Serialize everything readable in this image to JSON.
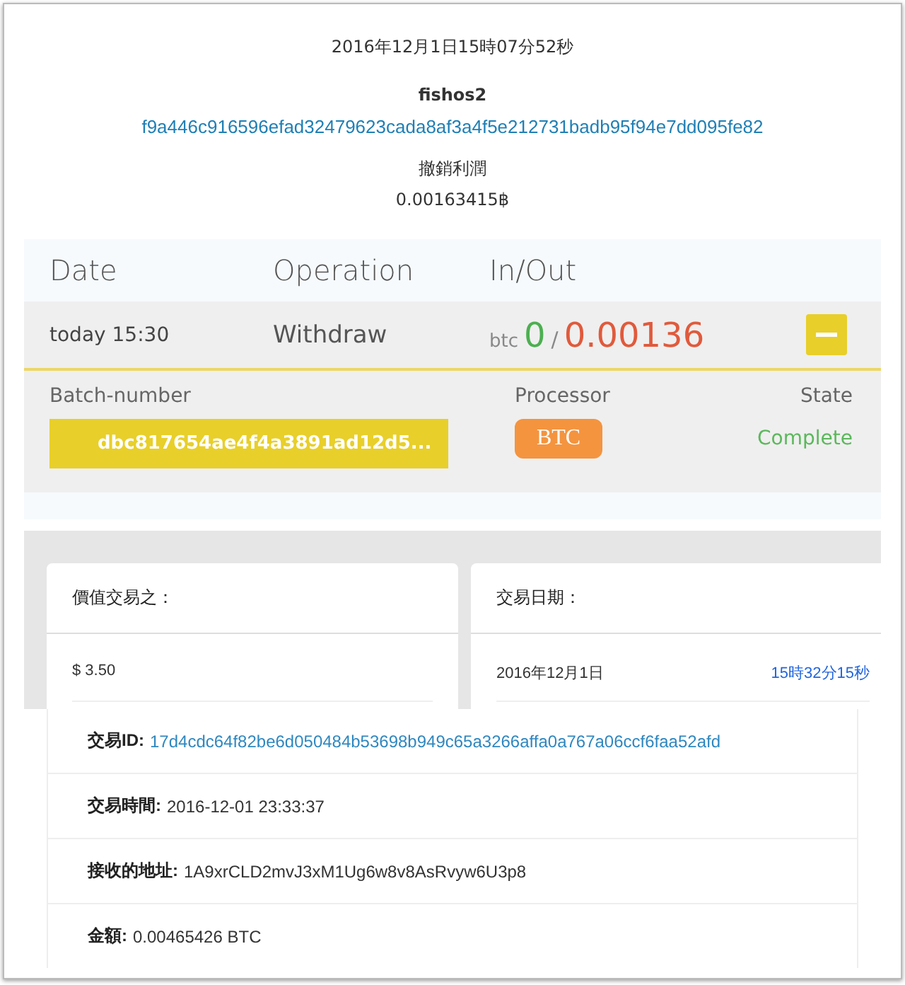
{
  "header": {
    "timestamp": "2016年12月1日15時07分52秒",
    "user": "fishos2",
    "hash": "f9a446c916596efad32479623cada8af3a4f5e212731badb95f94e7dd095fe82",
    "label": "撤銷利潤",
    "amount": "0.00163415฿"
  },
  "table": {
    "columns": [
      "Date",
      "Operation",
      "In/Out"
    ],
    "row": {
      "date": "today 15:30",
      "operation": "Withdraw",
      "unit": "btc",
      "in": "0",
      "sep": "/",
      "out": "0.00136",
      "expanded": true,
      "details": {
        "batch_label": "Batch-number",
        "batch": "dbc817654ae4f4a3891ad12d5...",
        "processor_label": "Processor",
        "processor": "BTC",
        "state_label": "State",
        "state": "Complete"
      }
    }
  },
  "cards": [
    {
      "title": "價值交易之：",
      "value": "$ 3.50"
    },
    {
      "title": "交易日期：",
      "value": "2016年12月1日",
      "extra": "15時32分15秒"
    }
  ],
  "info": [
    {
      "label": "交易ID:",
      "value": "17d4cdc64f82be6d050484b53698b949c65a3266affa0a767a06ccf6faa52afd",
      "kind": "link"
    },
    {
      "label": "交易時間:",
      "value": "2016-12-01 23:33:37",
      "kind": "text"
    },
    {
      "label": "接收的地址:",
      "value": "1A9xrCLD2mvJ3xM1Ug6w8v8AsRvyw6U3p8",
      "kind": "text"
    },
    {
      "label": "金額:",
      "value": "0.00465426 BTC",
      "kind": "text"
    }
  ]
}
